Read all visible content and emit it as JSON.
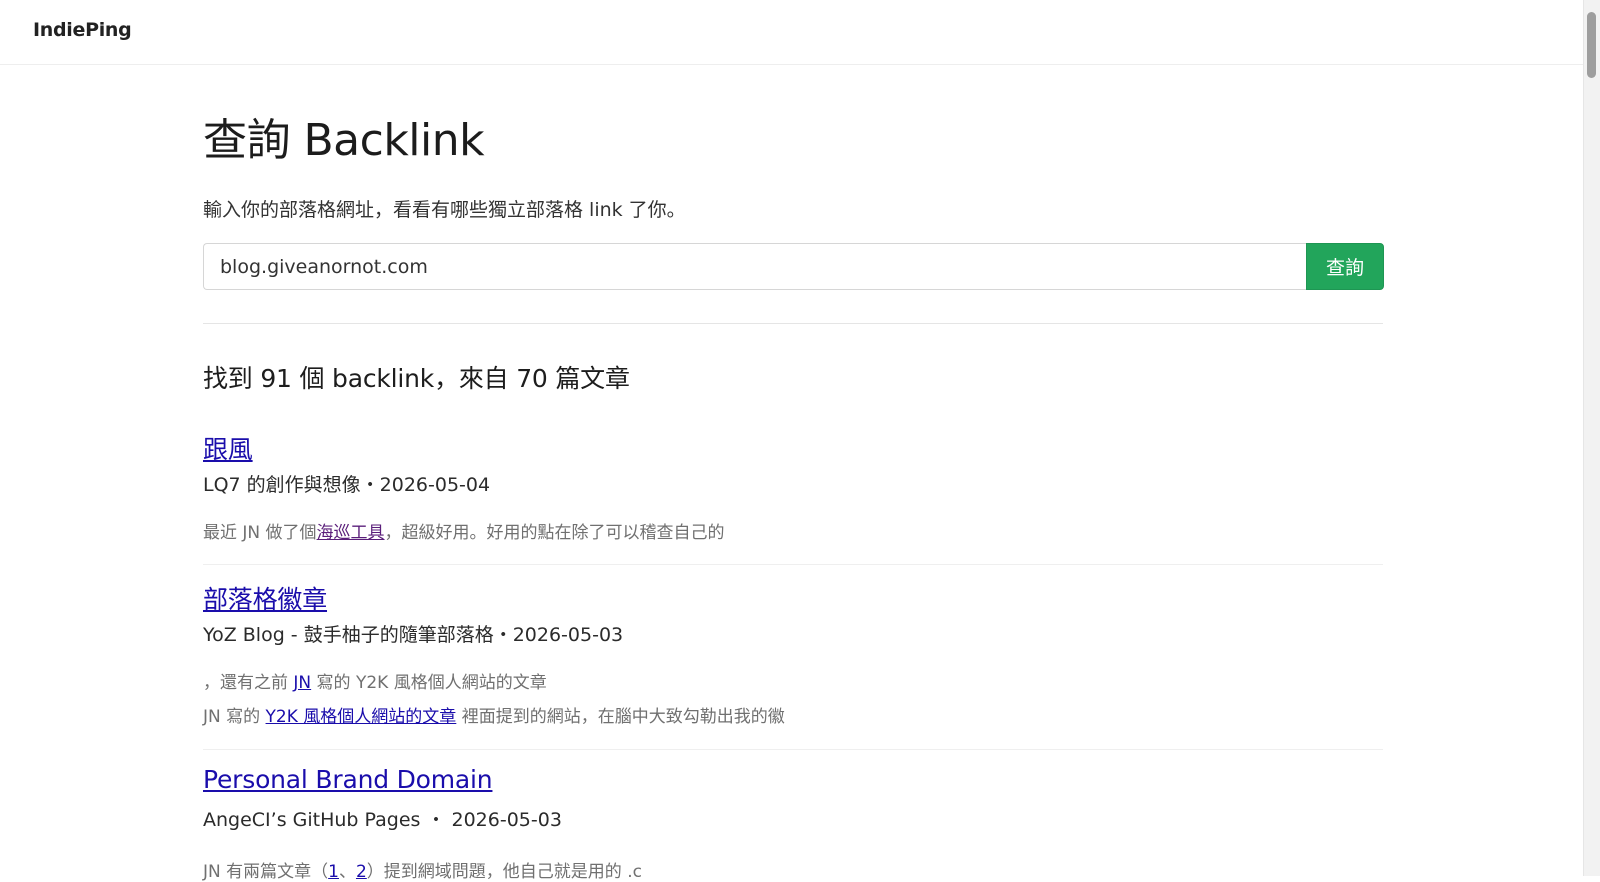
{
  "header": {
    "brand": "IndiePing"
  },
  "page": {
    "title": "查詢 Backlink",
    "subtitle": "輸入你的部落格網址，看看有哪些獨立部落格 link 了你。"
  },
  "search": {
    "value": "blog.giveanornot.com",
    "button_label": "查詢"
  },
  "results": {
    "summary": "找到 91 個 backlink，來自 70 篇文章",
    "items": [
      {
        "title": "跟風",
        "meta": "LQ7 的創作與想像・2026-05-04",
        "snippets": [
          {
            "before": "最近 JN 做了個",
            "link": "海巡工具",
            "after": "，超級好用。好用的點在除了可以稽查自己的"
          }
        ]
      },
      {
        "title": "部落格徽章",
        "meta": "YoZ Blog - 鼓手柚子的隨筆部落格・2026-05-03",
        "snippets": [
          {
            "before": "，還有之前 ",
            "link": "JN",
            "after": " 寫的 Y2K 風格個人網站的文章"
          },
          {
            "before": "JN 寫的 ",
            "link": "Y2K 風格個人網站的文章",
            "after": " 裡面提到的網站，在腦中大致勾勒出我的徽"
          }
        ]
      },
      {
        "title": "Personal Brand Domain",
        "meta": "AngeCI’s GitHub Pages ・ 2026-05-03",
        "snippets": [
          {
            "before": "JN 有兩篇文章（",
            "link": "1",
            "middle": "、",
            "link2": "2",
            "after": "）提到網域問題，他自己就是用的 .c"
          }
        ]
      }
    ]
  }
}
